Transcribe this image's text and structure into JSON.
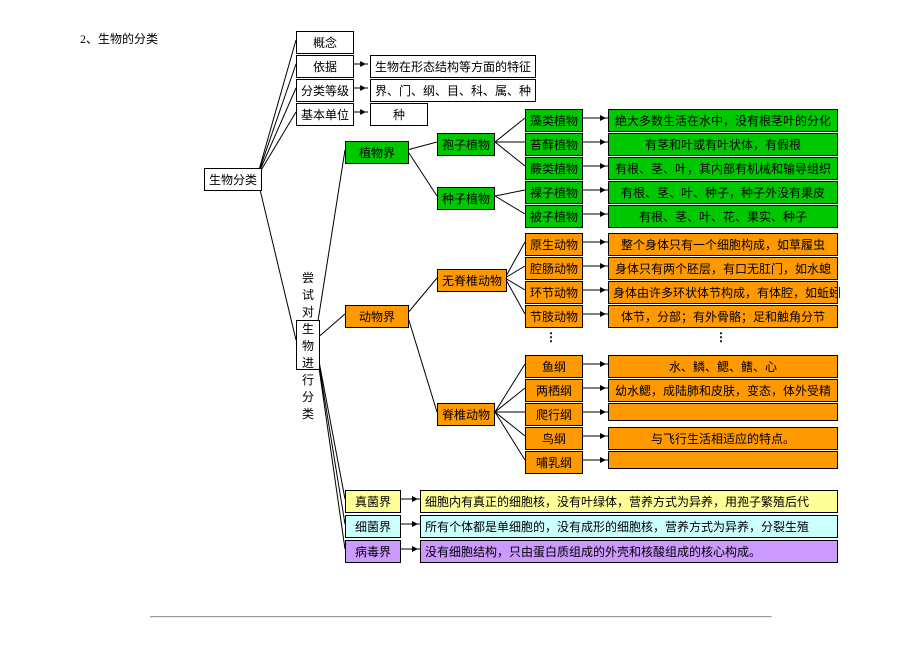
{
  "heading": "2、生物的分类",
  "root": "生物分类",
  "try": "尝试对生物\n进行分类",
  "top": {
    "concept": "概念",
    "basis": "依据",
    "basis_txt": "生物在形态结构等方面的特征",
    "rank": "分类等级",
    "rank_txt": "界、门、纲、目、科、属、种",
    "unit": "基本单位",
    "unit_txt": "种"
  },
  "plant": {
    "kingdom": "植物界",
    "spore": "孢子植物",
    "seed": "种子植物",
    "algae": "藻类植物",
    "algae_txt": "绝大多数生活在水中，没有根茎叶的分化",
    "moss": "苔藓植物",
    "moss_txt": "有茎和叶或有叶状体，有假根",
    "fern": "蕨类植物",
    "fern_txt": "有根、茎、叶，其内部有机械和输导组织",
    "gymno": "裸子植物",
    "gymno_txt": "有根、茎、叶、种子，种子外没有果皮",
    "angio": "被子植物",
    "angio_txt": "有根、茎、叶、花、果实、种子"
  },
  "animal": {
    "kingdom": "动物界",
    "invert": "无脊椎动物",
    "vert": "脊椎动物",
    "proto": "原生动物",
    "proto_txt": "整个身体只有一个细胞构成，如草履虫",
    "coel": "腔肠动物",
    "coel_txt": "身体只有两个胚层，有口无肛门，如水螅",
    "annel": "环节动物",
    "annel_txt": "身体由许多环状体节构成，有体腔，如蚯蚓",
    "arthro": "节肢动物",
    "arthro_txt": "体节，分部；有外骨骼；足和触角分节",
    "fish": "鱼纲",
    "fish_txt": "水、鳞、鳃、鳍、心",
    "amph": "两栖纲",
    "amph_txt": "幼水鳃，成陆肺和皮肤，变态，体外受精",
    "rept": "爬行纲",
    "bird": "鸟纲",
    "bird_txt": "与飞行生活相适应的特点。",
    "mamm": "哺乳纲"
  },
  "fungi": {
    "name": "真菌界",
    "txt": "细胞内有真正的细胞核，没有叶绿体，营养方式为异养，用孢子繁殖后代"
  },
  "bact": {
    "name": "细菌界",
    "txt": "所有个体都是单细胞的，没有成形的细胞核，营养方式为异养，分裂生殖"
  },
  "virus": {
    "name": "病毒界",
    "txt": "没有细胞结构，只由蛋白质组成的外壳和核酸组成的核心构成。"
  },
  "chart_data": {
    "type": "tree",
    "root": "生物分类",
    "children": [
      {
        "name": "概念"
      },
      {
        "name": "依据",
        "desc": "生物在形态结构等方面的特征"
      },
      {
        "name": "分类等级",
        "desc": "界、门、纲、目、科、属、种"
      },
      {
        "name": "基本单位",
        "desc": "种"
      },
      {
        "name": "尝试对生物进行分类",
        "children": [
          {
            "name": "植物界",
            "children": [
              {
                "name": "孢子植物",
                "children": [
                  {
                    "name": "藻类植物",
                    "desc": "绝大多数生活在水中，没有根茎叶的分化"
                  },
                  {
                    "name": "苔藓植物",
                    "desc": "有茎和叶或有叶状体，有假根"
                  },
                  {
                    "name": "蕨类植物",
                    "desc": "有根、茎、叶，其内部有机械和输导组织"
                  }
                ]
              },
              {
                "name": "种子植物",
                "children": [
                  {
                    "name": "裸子植物",
                    "desc": "有根、茎、叶、种子，种子外没有果皮"
                  },
                  {
                    "name": "被子植物",
                    "desc": "有根、茎、叶、花、果实、种子"
                  }
                ]
              }
            ]
          },
          {
            "name": "动物界",
            "children": [
              {
                "name": "无脊椎动物",
                "children": [
                  {
                    "name": "原生动物",
                    "desc": "整个身体只有一个细胞构成，如草履虫"
                  },
                  {
                    "name": "腔肠动物",
                    "desc": "身体只有两个胚层，有口无肛门，如水螅"
                  },
                  {
                    "name": "环节动物",
                    "desc": "身体由许多环状体节构成，有体腔，如蚯蚓"
                  },
                  {
                    "name": "节肢动物",
                    "desc": "体节，分部；有外骨骼；足和触角分节"
                  }
                ]
              },
              {
                "name": "脊椎动物",
                "children": [
                  {
                    "name": "鱼纲",
                    "desc": "水、鳞、鳃、鳍、心"
                  },
                  {
                    "name": "两栖纲",
                    "desc": "幼水鳃，成陆肺和皮肤，变态，体外受精"
                  },
                  {
                    "name": "爬行纲"
                  },
                  {
                    "name": "鸟纲",
                    "desc": "与飞行生活相适应的特点。"
                  },
                  {
                    "name": "哺乳纲"
                  }
                ]
              }
            ]
          },
          {
            "name": "真菌界",
            "desc": "细胞内有真正的细胞核，没有叶绿体，营养方式为异养，用孢子繁殖后代"
          },
          {
            "name": "细菌界",
            "desc": "所有个体都是单细胞的，没有成形的细胞核，营养方式为异养，分裂生殖"
          },
          {
            "name": "病毒界",
            "desc": "没有细胞结构，只由蛋白质组成的外壳和核酸组成的核心构成。"
          }
        ]
      }
    ]
  }
}
